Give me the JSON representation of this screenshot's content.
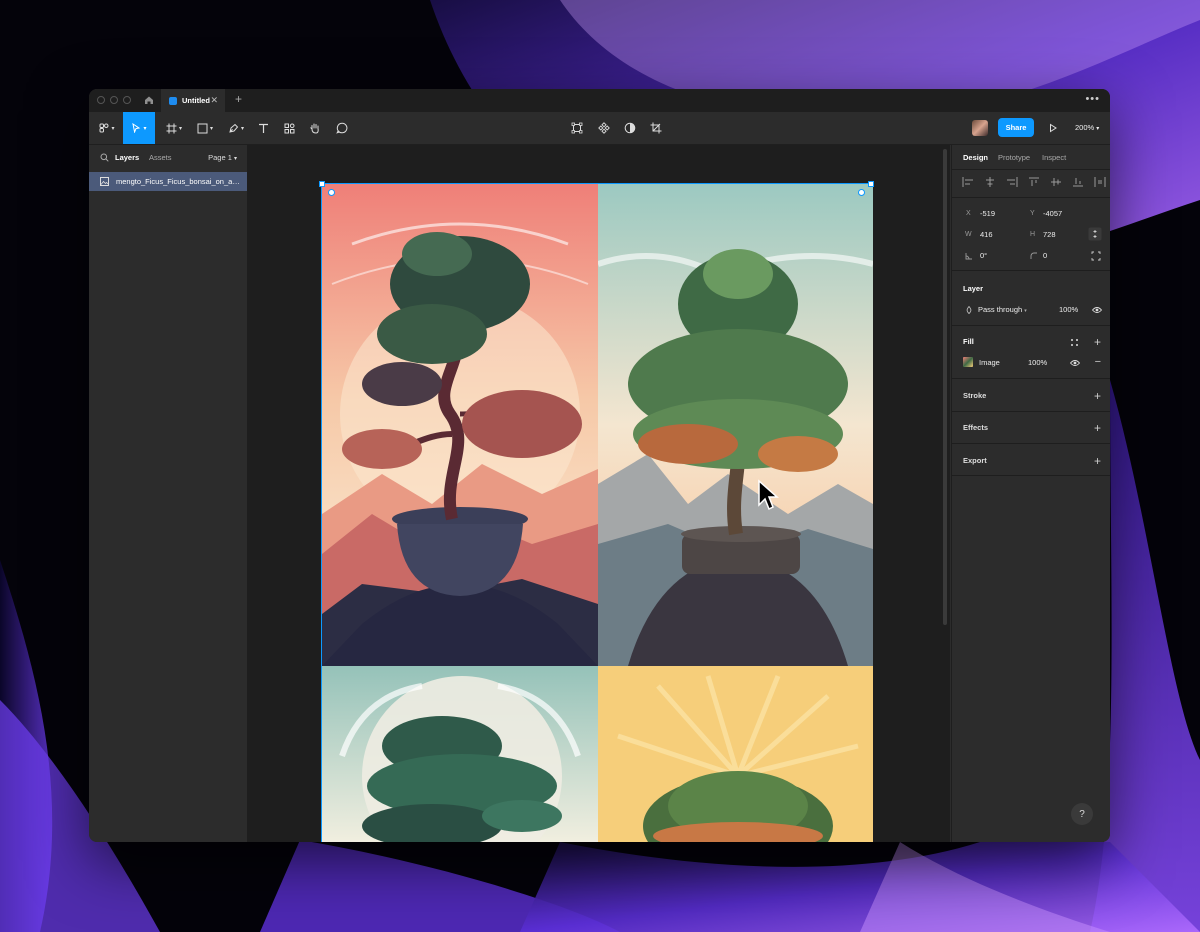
{
  "titlebar": {
    "tab_title": "Untitled"
  },
  "toolbar": {
    "share_label": "Share",
    "zoom": "200%"
  },
  "left_panel": {
    "tabs": [
      "Layers",
      "Assets"
    ],
    "page_selector": "Page 1",
    "layers": [
      {
        "name": "mengto_Ficus_Ficus_bonsai_on_a_..."
      }
    ]
  },
  "right_panel": {
    "tabs": [
      "Design",
      "Prototype",
      "Inspect"
    ],
    "props": {
      "x_label": "X",
      "x": "-519",
      "y_label": "Y",
      "y": "-4057",
      "w_label": "W",
      "w": "416",
      "h_label": "H",
      "h": "728",
      "rotation": "0°",
      "radius": "0"
    },
    "layer": {
      "title": "Layer",
      "blend": "Pass through",
      "opacity": "100%"
    },
    "fill": {
      "title": "Fill",
      "type": "Image",
      "opacity": "100%"
    },
    "stroke": {
      "title": "Stroke"
    },
    "effects": {
      "title": "Effects"
    },
    "export": {
      "title": "Export"
    }
  },
  "help_label": "?",
  "colors": {
    "accent": "#0d99ff",
    "panel": "#2c2c2c",
    "canvas": "#1e1e1e"
  },
  "icons": [
    "home-icon",
    "main-menu-icon",
    "move-tool-icon",
    "frame-tool-icon",
    "shape-tool-icon",
    "pen-tool-icon",
    "text-tool-icon",
    "resources-icon",
    "hand-tool-icon",
    "comment-icon",
    "component-icon",
    "mask-icon",
    "contrast-icon",
    "crop-icon",
    "play-icon",
    "search-icon",
    "eye-icon",
    "plus-icon",
    "minus-icon",
    "help-icon"
  ]
}
